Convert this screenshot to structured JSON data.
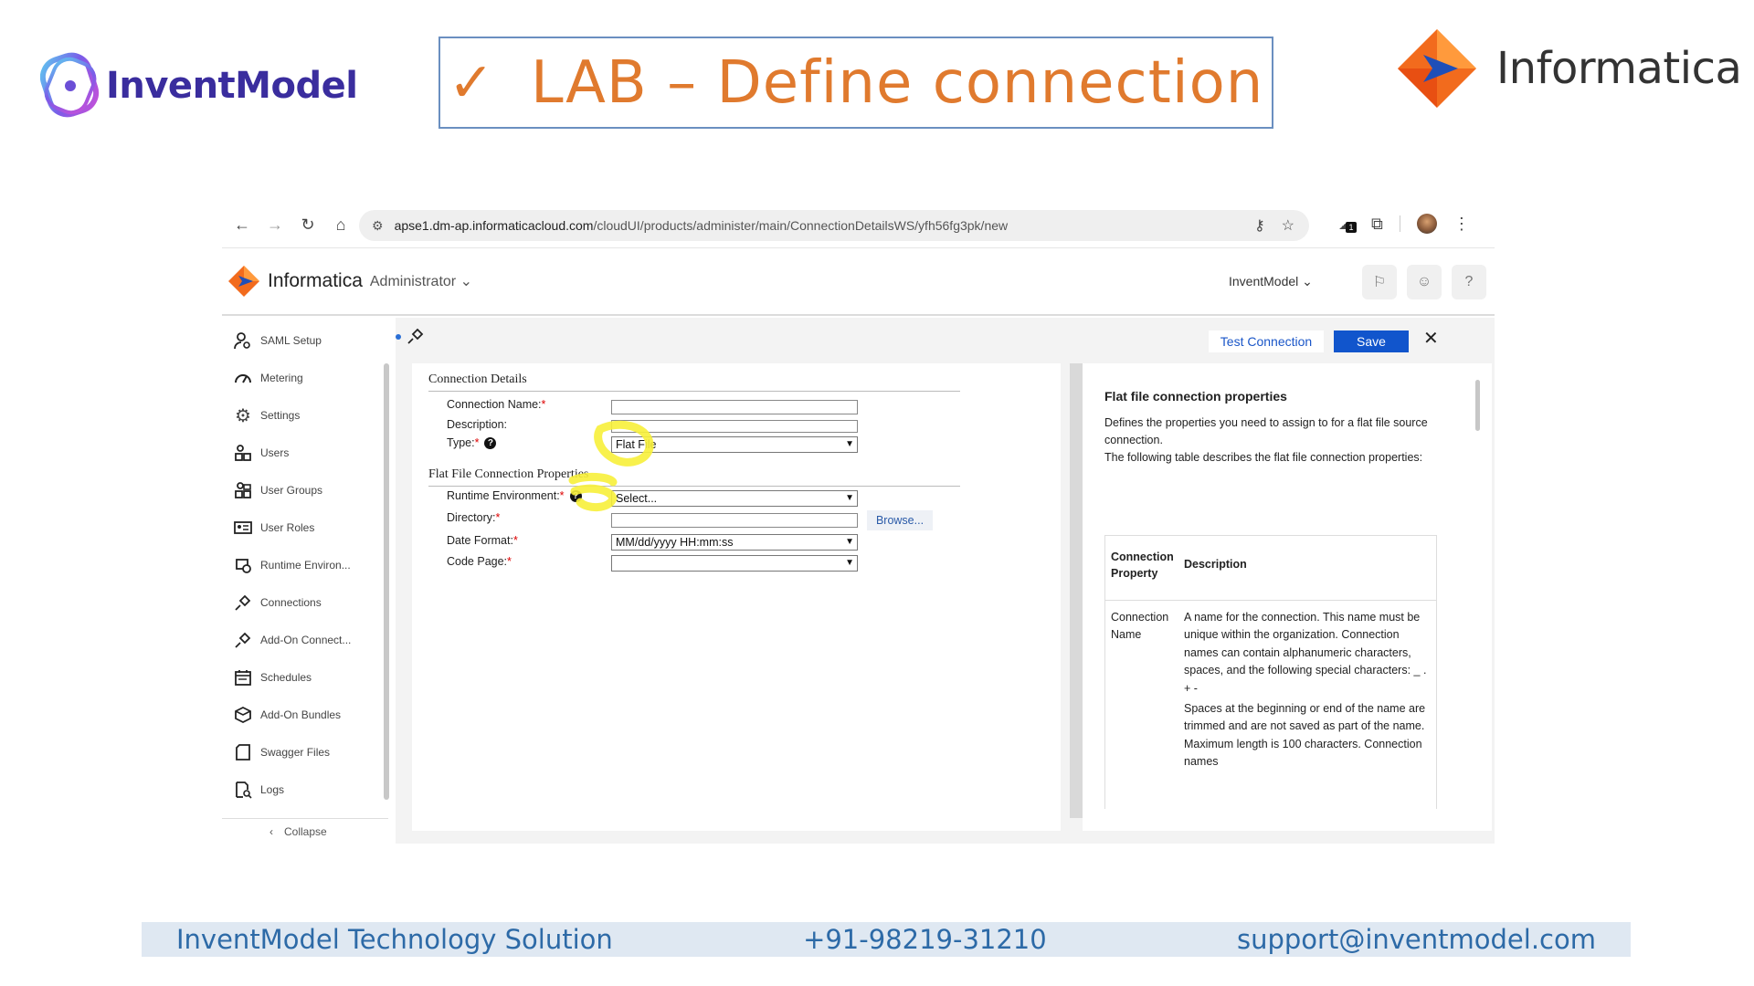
{
  "slide": {
    "brand_name": "InventModel",
    "title": "LAB – Define connection",
    "partner_name": "Informatica",
    "footer": {
      "company": "InventModel Technology Solution",
      "phone": "+91-98219-31210",
      "email": "support@inventmodel.com"
    },
    "colors": {
      "title": "#e07a2e",
      "footer_text": "#2d6aa7",
      "footer_bg": "#dfe8f2",
      "brand": "#3a2d9e"
    }
  },
  "browser": {
    "url_host": "apse1.dm-ap.informaticacloud.com",
    "url_path": "/cloudUI/products/administer/main/ConnectionDetailsWS/yfh56fg3pk/new",
    "extension_badge": "1"
  },
  "app": {
    "name": "Informatica",
    "module": "Administrator",
    "org": "InventModel"
  },
  "sidebar": {
    "items": [
      {
        "label": "SAML Setup",
        "icon": "saml-user-icon"
      },
      {
        "label": "Metering",
        "icon": "gauge-icon"
      },
      {
        "label": "Settings",
        "icon": "gear-icon"
      },
      {
        "label": "Users",
        "icon": "users-icon"
      },
      {
        "label": "User Groups",
        "icon": "user-groups-icon"
      },
      {
        "label": "User Roles",
        "icon": "id-card-icon"
      },
      {
        "label": "Runtime Environ...",
        "icon": "runtime-icon"
      },
      {
        "label": "Connections",
        "icon": "plug-icon"
      },
      {
        "label": "Add-On Connect...",
        "icon": "plug-icon"
      },
      {
        "label": "Schedules",
        "icon": "calendar-icon"
      },
      {
        "label": "Add-On Bundles",
        "icon": "cube-icon"
      },
      {
        "label": "Swagger Files",
        "icon": "file-icon"
      },
      {
        "label": "Logs",
        "icon": "log-search-icon"
      }
    ],
    "collapse_label": "Collapse"
  },
  "toolbar": {
    "test_label": "Test Connection",
    "save_label": "Save"
  },
  "form": {
    "details_title": "Connection Details",
    "name_label": "Connection Name:",
    "description_label": "Description:",
    "type_label": "Type:",
    "type_value": "Flat File",
    "props_title": "Flat File Connection Properties",
    "runtime_label": "Runtime Environment:",
    "runtime_value": "Select...",
    "directory_label": "Directory:",
    "browse_label": "Browse...",
    "date_label": "Date Format:",
    "date_value": "MM/dd/yyyy HH:mm:ss",
    "codepage_label": "Code Page:",
    "codepage_value": "",
    "required_mark": "*",
    "highlight_color": "#f7f03a"
  },
  "help": {
    "title": "Flat file connection properties",
    "p1": "Defines the properties you need to assign to for a flat file source connection.",
    "p2": "The following table describes the flat file connection properties:",
    "col1": "Connection Property",
    "col2": "Description",
    "row1_prop": "Connection Name",
    "row1_desc": "A name for the connection. This name must be unique within the organization. Connection names can contain alphanumeric characters, spaces, and the following special characters: _ . + -",
    "row1_desc2": "Spaces at the beginning or end of the name are trimmed and are not saved as part of the name. Maximum length is 100 characters. Connection names"
  }
}
